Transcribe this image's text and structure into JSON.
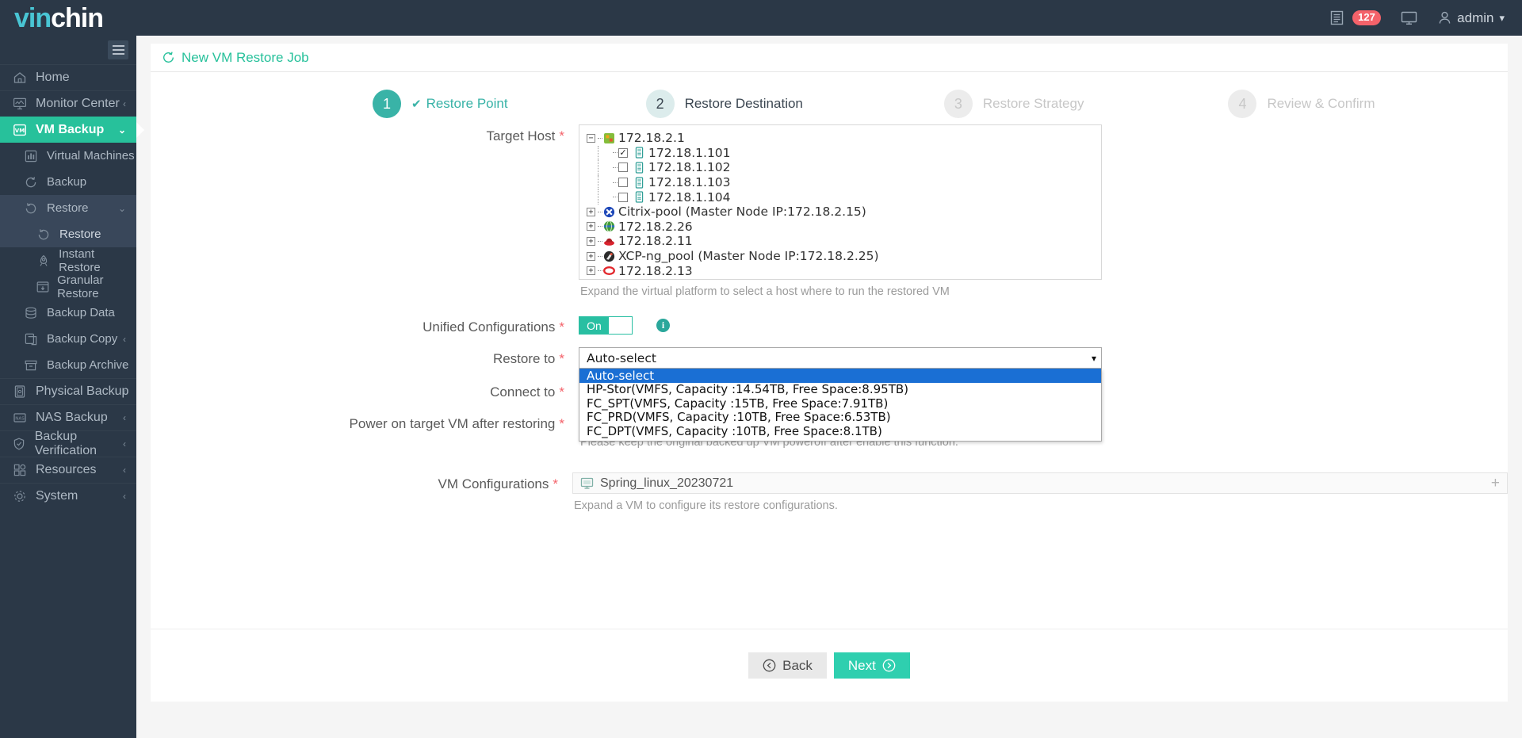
{
  "brand": {
    "part1": "vin",
    "part2": "chin",
    "accent": "#49c5d4"
  },
  "topbar": {
    "notifications_count": "127",
    "user_name": "admin",
    "icons": [
      "log-icon",
      "bell-icon",
      "monitor-icon",
      "user-icon",
      "chevron-down-icon"
    ]
  },
  "sidebar": {
    "items": [
      {
        "label": "Home",
        "icon": "home-icon",
        "chevron": "",
        "level": 0,
        "state": ""
      },
      {
        "label": "Monitor Center",
        "icon": "monitor-chart-icon",
        "chevron": "‹",
        "level": 0,
        "state": ""
      },
      {
        "label": "VM Backup",
        "icon": "vm-icon",
        "chevron": "⌄",
        "level": 0,
        "state": "active"
      },
      {
        "label": "Virtual Machines",
        "icon": "grid-icon",
        "chevron": "",
        "level": 1,
        "state": ""
      },
      {
        "label": "Backup",
        "icon": "backup-icon",
        "chevron": "",
        "level": 1,
        "state": ""
      },
      {
        "label": "Restore",
        "icon": "restore-icon",
        "chevron": "⌄",
        "level": 1,
        "state": "open"
      },
      {
        "label": "Restore",
        "icon": "restore-icon",
        "chevron": "",
        "level": 2,
        "state": "cur"
      },
      {
        "label": "Instant Restore",
        "icon": "rocket-icon",
        "chevron": "",
        "level": 2,
        "state": ""
      },
      {
        "label": "Granular Restore",
        "icon": "granular-icon",
        "chevron": "",
        "level": 2,
        "state": ""
      },
      {
        "label": "Backup Data",
        "icon": "database-icon",
        "chevron": "",
        "level": 1,
        "state": ""
      },
      {
        "label": "Backup Copy",
        "icon": "copy-icon",
        "chevron": "‹",
        "level": 1,
        "state": ""
      },
      {
        "label": "Backup Archive",
        "icon": "archive-icon",
        "chevron": "‹",
        "level": 1,
        "state": ""
      },
      {
        "label": "Physical Backup",
        "icon": "server-icon",
        "chevron": "‹",
        "level": 0,
        "state": ""
      },
      {
        "label": "NAS Backup",
        "icon": "nas-icon",
        "chevron": "‹",
        "level": 0,
        "state": ""
      },
      {
        "label": "Backup Verification",
        "icon": "shield-check-icon",
        "chevron": "‹",
        "level": 0,
        "state": ""
      },
      {
        "label": "Resources",
        "icon": "resources-icon",
        "chevron": "‹",
        "level": 0,
        "state": ""
      },
      {
        "label": "System",
        "icon": "gear-icon",
        "chevron": "‹",
        "level": 0,
        "state": ""
      }
    ]
  },
  "page": {
    "title": "New VM Restore Job",
    "title_icon": "restore-icon",
    "accent": "#27c19b"
  },
  "stepper": {
    "steps": [
      {
        "number": "1",
        "label": "Restore Point",
        "state": "done",
        "check": "✔"
      },
      {
        "number": "2",
        "label": "Restore Destination",
        "state": "curr",
        "check": ""
      },
      {
        "number": "3",
        "label": "Restore Strategy",
        "state": "off",
        "check": ""
      },
      {
        "number": "4",
        "label": "Review & Confirm",
        "state": "off",
        "check": ""
      }
    ]
  },
  "form": {
    "target_host": {
      "label": "Target Host",
      "required": "*",
      "hint": "Expand the virtual platform to select a host where to run the restored VM",
      "tree": [
        {
          "label": "172.18.2.1",
          "expander": "−",
          "icon": "vmware-platform-icon",
          "checkbox": false,
          "level": 0
        },
        {
          "label": "172.18.1.101",
          "expander": "",
          "icon": "host-icon",
          "checkbox": true,
          "checked": true,
          "level": 1
        },
        {
          "label": "172.18.1.102",
          "expander": "",
          "icon": "host-icon",
          "checkbox": true,
          "checked": false,
          "level": 1
        },
        {
          "label": "172.18.1.103",
          "expander": "",
          "icon": "host-icon",
          "checkbox": true,
          "checked": false,
          "level": 1
        },
        {
          "label": "172.18.1.104",
          "expander": "",
          "icon": "host-icon",
          "checkbox": true,
          "checked": false,
          "level": 1
        },
        {
          "label": "Citrix-pool (Master Node IP:172.18.2.15)",
          "expander": "+",
          "icon": "citrix-icon",
          "checkbox": false,
          "level": 0
        },
        {
          "label": "172.18.2.26",
          "expander": "+",
          "icon": "proxmox-globe-icon",
          "checkbox": false,
          "level": 0
        },
        {
          "label": "172.18.2.11",
          "expander": "+",
          "icon": "redhat-icon",
          "checkbox": false,
          "level": 0
        },
        {
          "label": "XCP-ng_pool (Master Node IP:172.18.2.25)",
          "expander": "+",
          "icon": "xcpng-icon",
          "checkbox": false,
          "level": 0
        },
        {
          "label": "172.18.2.13",
          "expander": "+",
          "icon": "ovirt-icon",
          "checkbox": false,
          "level": 0
        }
      ]
    },
    "unified_configurations": {
      "label": "Unified Configurations",
      "required": "*",
      "toggle_state": "On",
      "info_icon": "info-icon",
      "info_glyph": "i"
    },
    "restore_to": {
      "label": "Restore to",
      "required": "*",
      "value": "Auto-select",
      "expanded": true,
      "options": [
        "Auto-select",
        "HP-Stor(VMFS, Capacity :14.54TB, Free Space:8.95TB)",
        "FC_SPT(VMFS, Capacity :15TB, Free Space:7.91TB)",
        "FC_PRD(VMFS, Capacity :10TB, Free Space:6.53TB)",
        "FC_DPT(VMFS, Capacity :10TB, Free Space:8.1TB)"
      ],
      "selected_index": 0,
      "highlight_color": "#1a6fd4"
    },
    "connect_to": {
      "label": "Connect to",
      "required": "*"
    },
    "power_on": {
      "label": "Power on target VM after restoring",
      "required": "*",
      "hint": "Please keep the original backed up VM poweroff after enable this function."
    },
    "vm_configurations": {
      "label": "VM Configurations",
      "required": "*",
      "vm_name": "Spring_linux_20230721",
      "vm_icon": "vm-monitor-icon",
      "expand_icon": "plus-icon",
      "hint": "Expand a VM to configure its restore configurations."
    }
  },
  "footer": {
    "back_label": "Back",
    "back_icon": "arrow-left-circle-icon",
    "next_label": "Next",
    "next_icon": "arrow-right-circle-icon"
  }
}
